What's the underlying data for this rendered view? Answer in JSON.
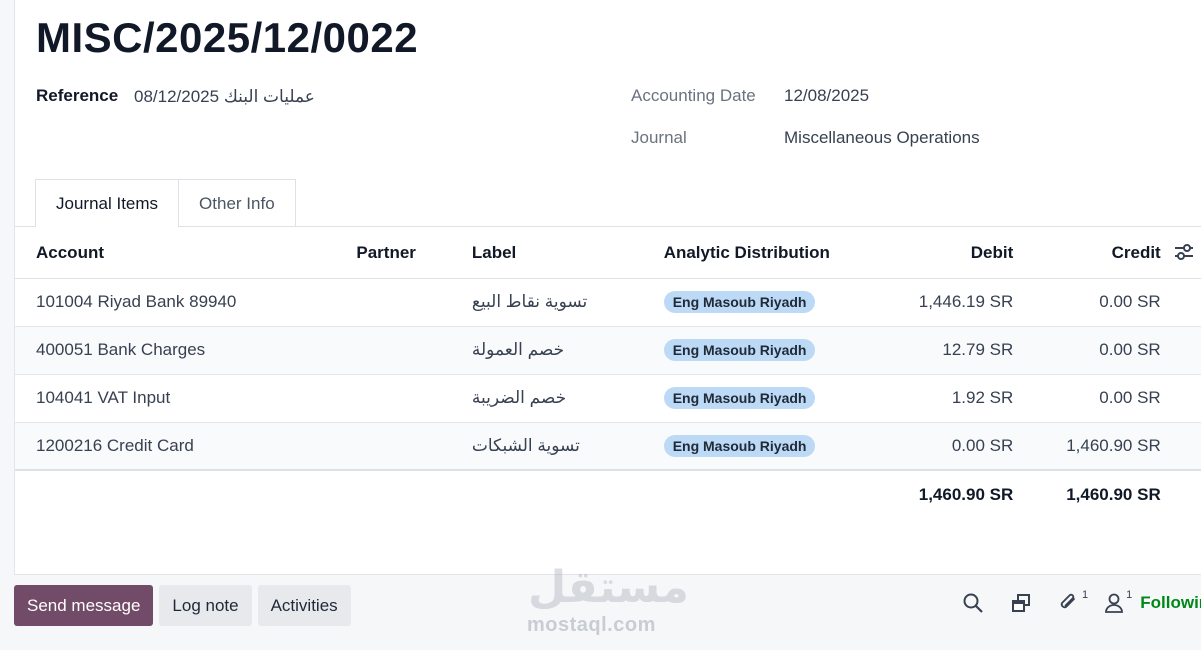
{
  "record": {
    "title": "MISC/2025/12/0022",
    "reference_label": "Reference",
    "reference_value": "عمليات البنك 08/12/2025",
    "accounting_date_label": "Accounting Date",
    "accounting_date_value": "12/08/2025",
    "journal_label": "Journal",
    "journal_value": "Miscellaneous Operations"
  },
  "tabs": [
    {
      "label": "Journal Items",
      "active": true
    },
    {
      "label": "Other Info",
      "active": false
    }
  ],
  "table": {
    "headers": {
      "account": "Account",
      "partner": "Partner",
      "label": "Label",
      "analytic": "Analytic Distribution",
      "debit": "Debit",
      "credit": "Credit"
    },
    "rows": [
      {
        "account": "101004 Riyad Bank 89940",
        "partner": "",
        "label": "تسوية نقاط البيع",
        "analytic": "Eng Masoub Riyadh",
        "debit": "1,446.19 SR",
        "credit": "0.00 SR"
      },
      {
        "account": "400051 Bank Charges",
        "partner": "",
        "label": "خصم العمولة",
        "analytic": "Eng Masoub Riyadh",
        "debit": "12.79 SR",
        "credit": "0.00 SR"
      },
      {
        "account": "104041 VAT Input",
        "partner": "",
        "label": "خصم الضريبة",
        "analytic": "Eng Masoub Riyadh",
        "debit": "1.92 SR",
        "credit": "0.00 SR"
      },
      {
        "account": "1200216 Credit Card",
        "partner": "",
        "label": "تسوية الشبكات",
        "analytic": "Eng Masoub Riyadh",
        "debit": "0.00 SR",
        "credit": "1,460.90 SR"
      }
    ],
    "totals": {
      "debit": "1,460.90 SR",
      "credit": "1,460.90 SR"
    }
  },
  "chatter": {
    "send_message": "Send message",
    "log_note": "Log note",
    "activities": "Activities",
    "attachments_count": "1",
    "followers_count": "1",
    "following": "Following"
  },
  "watermark": {
    "arabic": "مستقل",
    "latin": "mostaql.com"
  },
  "colors": {
    "primary_button": "#714b67",
    "tag_bg": "#bcd9f5",
    "following": "#008818"
  }
}
